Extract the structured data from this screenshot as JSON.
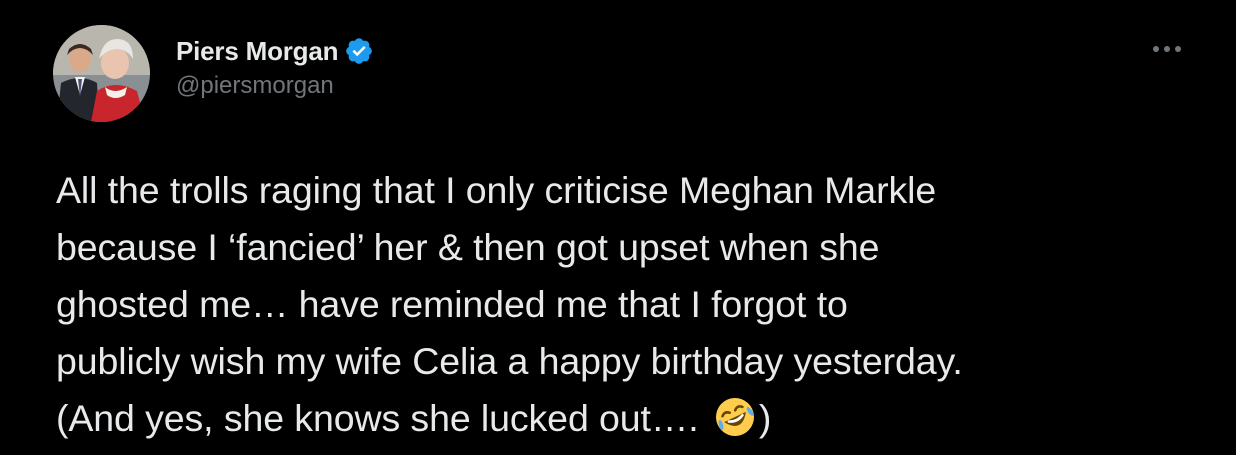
{
  "tweet": {
    "author": {
      "display_name": "Piers Morgan",
      "handle": "@piersmorgan",
      "verified": true
    },
    "text_lines": [
      "All the trolls raging that I only criticise Meghan Markle",
      "because I ‘fancied’ her & then got upset when she",
      "ghosted me… have reminded me that I forgot to",
      "publicly wish my wife Celia a happy birthday yesterday.",
      "(And yes, she knows she lucked out…. "
    ],
    "text_tail": ")",
    "emoji": "rolling-on-floor-laughing",
    "icons": {
      "verified": "verified-badge-icon",
      "more": "more-options-icon"
    },
    "colors": {
      "background": "#000000",
      "text": "#e7e9ea",
      "secondary": "#71767b",
      "verified": "#1d9bf0"
    }
  }
}
